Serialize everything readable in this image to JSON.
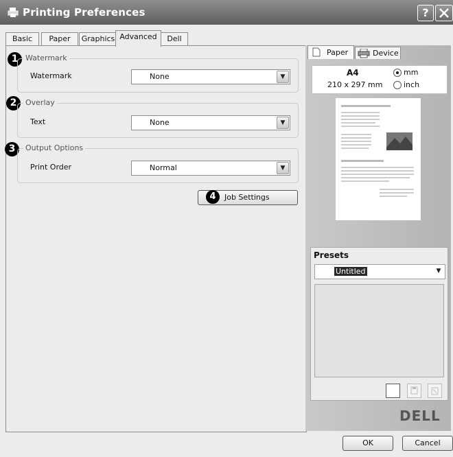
{
  "window": {
    "title": "Printing Preferences",
    "help_button": "?",
    "close_button": "X"
  },
  "tabs": [
    {
      "label": "Basic"
    },
    {
      "label": "Paper"
    },
    {
      "label": "Graphics"
    },
    {
      "label": "Advanced"
    },
    {
      "label": "Dell"
    }
  ],
  "active_tab": "Advanced",
  "groups": {
    "watermark": {
      "callout": "1",
      "legend": "Watermark",
      "label": "Watermark",
      "value": "None"
    },
    "overlay": {
      "callout": "2",
      "legend": "Overlay",
      "label": "Text",
      "value": "None"
    },
    "output": {
      "callout": "3",
      "legend": "Output Options",
      "label": "Print Order",
      "value": "Normal"
    }
  },
  "job_settings": {
    "callout": "4",
    "label": "Job Settings"
  },
  "preview_pane": {
    "tabs": [
      {
        "label": "Paper"
      },
      {
        "label": "Device"
      }
    ],
    "paper_size": "A4",
    "paper_dims": "210 x 297 mm",
    "units": [
      {
        "label": "mm",
        "selected": true
      },
      {
        "label": "inch",
        "selected": false
      }
    ]
  },
  "presets": {
    "title": "Presets",
    "selected": "Untitled"
  },
  "brand_logo": "DELL",
  "footer": {
    "ok_label": "OK",
    "cancel_label": "Cancel"
  }
}
